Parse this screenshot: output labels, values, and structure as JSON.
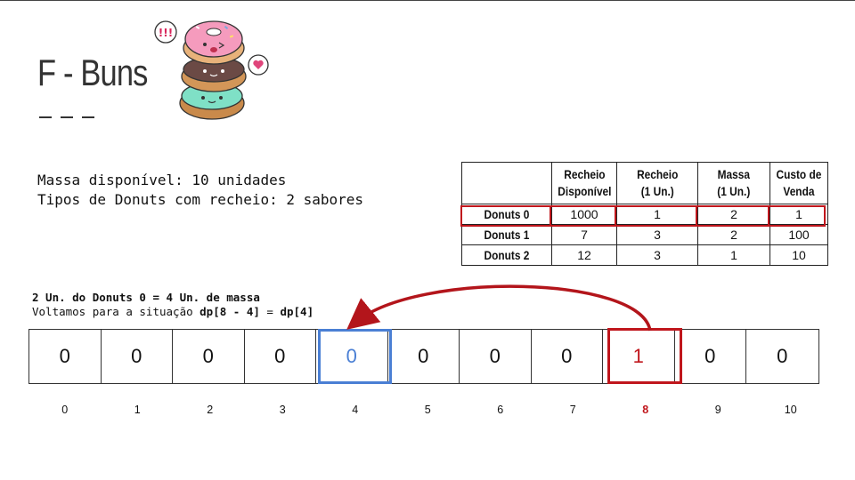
{
  "title": "F - Buns",
  "description": {
    "line1": "Massa disponível: 10 unidades",
    "line2": "Tipos de Donuts com recheio: 2 sabores"
  },
  "table": {
    "headers": [
      "",
      "Recheio Disponível",
      "Recheio (1 Un.)",
      "Massa (1 Un.)",
      "Custo de Venda"
    ],
    "header_lines": [
      [
        "",
        ""
      ],
      [
        "Recheio",
        "Disponível"
      ],
      [
        "Recheio",
        "(1 Un.)"
      ],
      [
        "Massa",
        "(1 Un.)"
      ],
      [
        "Custo de",
        "Venda"
      ]
    ],
    "rows": [
      {
        "label": "Donuts 0",
        "values": [
          "1000",
          "1",
          "2",
          "1"
        ]
      },
      {
        "label": "Donuts 1",
        "values": [
          "7",
          "3",
          "2",
          "100"
        ]
      },
      {
        "label": "Donuts 2",
        "values": [
          "12",
          "3",
          "1",
          "10"
        ]
      }
    ],
    "highlighted_row": 0,
    "highlight_color": "#c0161c"
  },
  "note": {
    "line1": "2 Un. do Donuts 0 = 4 Un. de massa",
    "line2_prefix": "Voltamos para a situação ",
    "line2_bold1": "dp[8 - 4]",
    "line2_mid": " = ",
    "line2_bold2": "dp[4]"
  },
  "dp": {
    "values": [
      "0",
      "0",
      "0",
      "0",
      "0",
      "0",
      "0",
      "0",
      "1",
      "0",
      "0"
    ],
    "indices": [
      "0",
      "1",
      "2",
      "3",
      "4",
      "5",
      "6",
      "7",
      "8",
      "9",
      "10"
    ],
    "source_index": 8,
    "target_index": 4,
    "source_color": "#c0161c",
    "target_color": "#4a7fd4"
  },
  "illustration": "stacked-donuts-icon"
}
